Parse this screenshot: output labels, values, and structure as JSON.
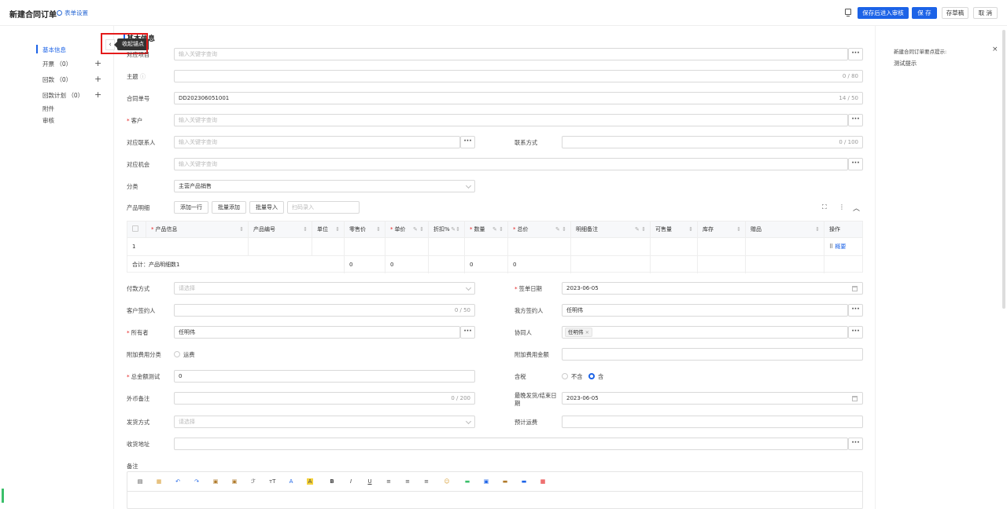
{
  "header": {
    "title": "新建合同订单",
    "form_settings": "表单设置",
    "btn_save_review": "保存后进入审核",
    "btn_save": "保 存",
    "btn_draft": "存草稿",
    "btn_cancel": "取 消"
  },
  "nav": {
    "items": [
      "基本信息",
      "开票 （0）",
      "回款 （0）",
      "回款计划 （0）",
      "附件",
      "审核"
    ]
  },
  "tooltip": "收起锚点",
  "section_title": "基本信息",
  "fields": {
    "opportunity": {
      "label": "对应项目",
      "placeholder": "输入关键字查询"
    },
    "subject": {
      "label": "主题",
      "counter": "0 / 80"
    },
    "contract_no": {
      "label": "合同单号",
      "value": "DD202306051001",
      "counter": "14 / 50"
    },
    "customer": {
      "label": "客户",
      "placeholder": "输入关键字查询"
    },
    "contact": {
      "label": "对应联系人",
      "placeholder": "输入关键字查询"
    },
    "contact_method": {
      "label": "联系方式",
      "counter": "0 / 100"
    },
    "chance": {
      "label": "对应机会",
      "placeholder": "输入关键字查询"
    },
    "category": {
      "label": "分类",
      "value": "主营产品销售"
    },
    "product_detail": {
      "label": "产品明细",
      "btn_add_row": "添加一行",
      "btn_batch_add": "批量添加",
      "btn_batch_import": "批量导入",
      "scan_placeholder": "扫码录入"
    },
    "payment": {
      "label": "付款方式",
      "placeholder": "请选择"
    },
    "sign_date": {
      "label": "签单日期",
      "value": "2023-06-05"
    },
    "customer_signer": {
      "label": "客户签约人",
      "counter": "0 / 50"
    },
    "our_signer": {
      "label": "我方签约人",
      "value": "任明伟"
    },
    "owner": {
      "label": "所有者",
      "value": "任明伟"
    },
    "collaborator": {
      "label": "协同人",
      "tag": "任明伟"
    },
    "extra_fee_type": {
      "label": "附加费用分类",
      "option": "运费"
    },
    "extra_fee_amount": {
      "label": "附加费用金额"
    },
    "total_amount": {
      "label": "总金额测试",
      "value": "0"
    },
    "tax": {
      "label": "含税",
      "opt_no": "不含",
      "opt_yes": "含"
    },
    "foreign_note": {
      "label": "外币备注",
      "counter": "0 / 200"
    },
    "last_ship_date": {
      "label": "最晚发货/结束日期",
      "value": "2023-06-05"
    },
    "ship_method": {
      "label": "发货方式",
      "placeholder": "请选择"
    },
    "est_freight": {
      "label": "预计运费"
    },
    "address": {
      "label": "收货地址"
    },
    "remark": {
      "label": "备注"
    }
  },
  "table": {
    "headers": [
      "产品信息",
      "产品编号",
      "单位",
      "零售价",
      "单价",
      "折扣%",
      "数量",
      "总价",
      "明细备注",
      "可售量",
      "库存",
      "赠品",
      "操作"
    ],
    "row_index": "1",
    "row_action": "概要",
    "summary_label": "合计：产品明细数1",
    "summary_values": [
      "0",
      "0",
      "0",
      "0"
    ]
  },
  "right_panel": {
    "title": "新建合同订单要点提示:",
    "text": "测试提示"
  },
  "colors": {
    "primary": "#1c63e7",
    "required": "#e41b1b",
    "highlight": "#e41b1b"
  }
}
